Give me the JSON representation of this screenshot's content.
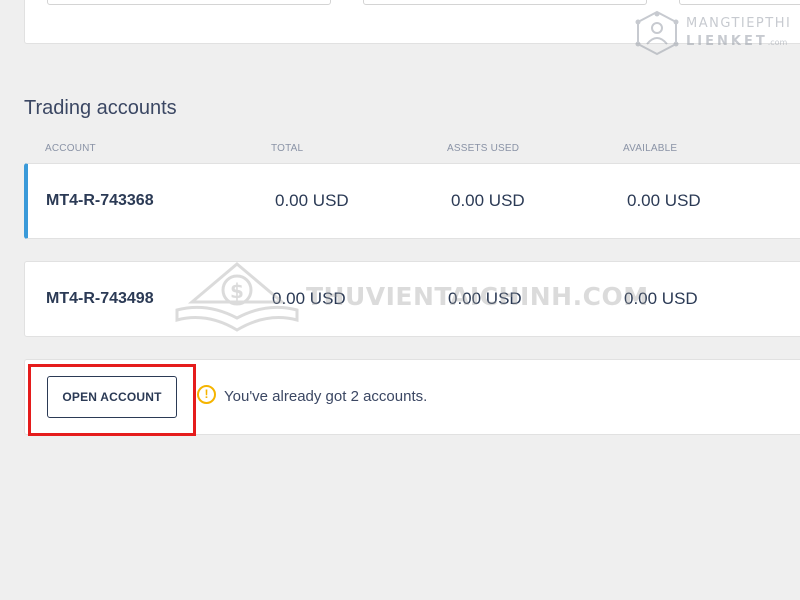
{
  "section_title": "Trading accounts",
  "columns": [
    "ACCOUNT",
    "TOTAL",
    "ASSETS USED",
    "AVAILABLE"
  ],
  "accounts": [
    {
      "id": "MT4-R-743368",
      "total": "0.00 USD",
      "assets_used": "0.00 USD",
      "available": "0.00 USD",
      "selected": true
    },
    {
      "id": "MT4-R-743498",
      "total": "0.00 USD",
      "assets_used": "0.00 USD",
      "available": "0.00 USD",
      "selected": false
    }
  ],
  "open_account": {
    "button_label": "OPEN ACCOUNT",
    "warning_icon": "!",
    "warning_text": "You've already got 2 accounts."
  },
  "watermarks": {
    "top_line1": "MANGTIEPTHI",
    "top_line2": "LIENKET",
    "top_suffix": ".com",
    "center": "THUVIENTAICHINH.COM"
  },
  "colors": {
    "accent": "#3a9ad9",
    "highlight": "#e51c1c",
    "warning": "#f5b400",
    "text": "#2b3a55"
  }
}
